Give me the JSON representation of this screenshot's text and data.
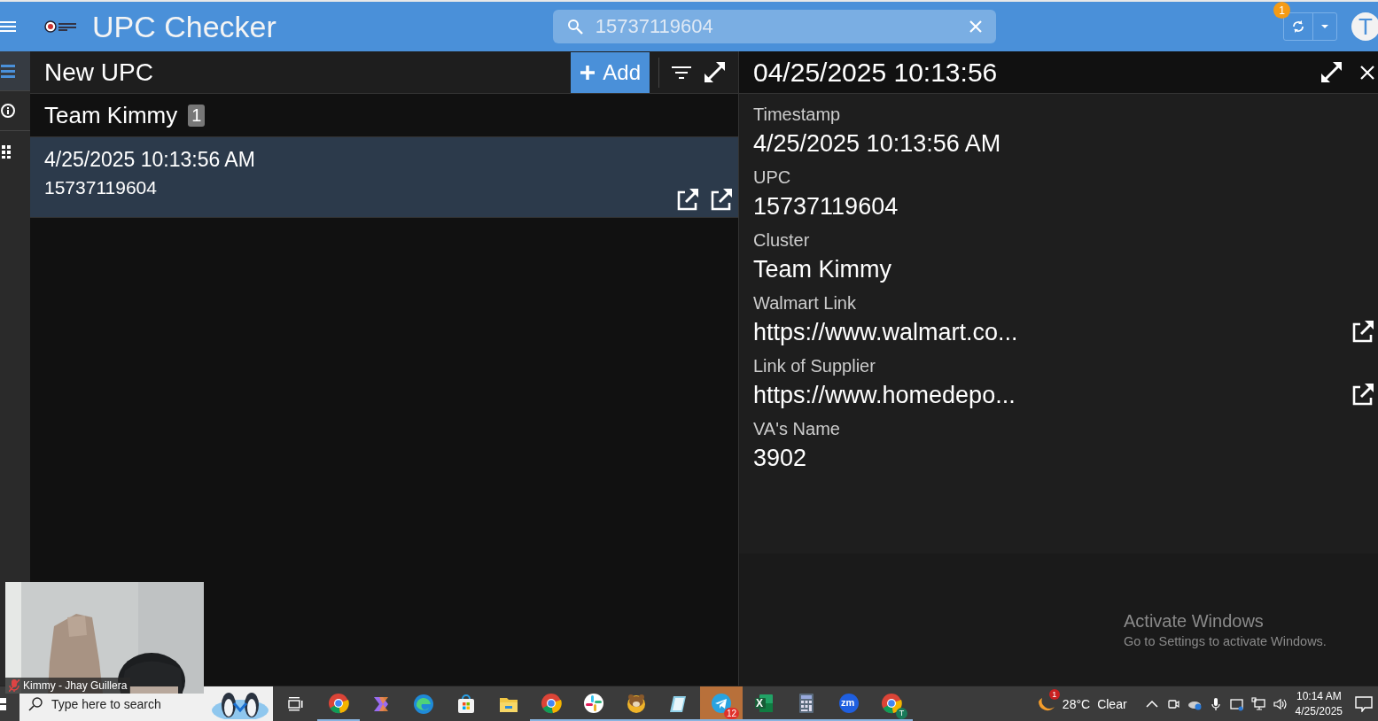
{
  "app_bar": {
    "title": "UPC Checker",
    "search": {
      "value": "15737119604"
    },
    "sync_badge": "1",
    "avatar": "T"
  },
  "rail": {
    "items": [
      {
        "selected": true
      },
      {
        "selected": false
      },
      {
        "selected": false
      }
    ]
  },
  "list_panel": {
    "title": "New UPC",
    "add_label": "Add",
    "groups": [
      {
        "name": "Team Kimmy",
        "count": "1",
        "items": [
          {
            "title": "4/25/2025 10:13:56 AM",
            "subtitle": "15737119604",
            "selected": true
          }
        ]
      }
    ]
  },
  "detail_panel": {
    "title": "04/25/2025 10:13:56",
    "fields": [
      {
        "label": "Timestamp",
        "value": "4/25/2025 10:13:56 AM",
        "kind": "text"
      },
      {
        "label": "UPC",
        "value": "15737119604",
        "kind": "text"
      },
      {
        "label": "Cluster",
        "value": "Team Kimmy",
        "kind": "text"
      },
      {
        "label": "Walmart Link",
        "value": "https://www.walmart.co...",
        "kind": "link"
      },
      {
        "label": "Link of Supplier",
        "value": "https://www.homedepo...",
        "kind": "link"
      },
      {
        "label": "VA's Name",
        "value": "3902",
        "kind": "text"
      }
    ]
  },
  "video_overlay": {
    "kind": "picture",
    "name": "Kimmy - Jhay Guillera",
    "muted": true
  },
  "activation_notice": {
    "title": "Activate Windows",
    "text": "Go to Settings to activate Windows."
  },
  "taskbar": {
    "search_placeholder": "Type here to search",
    "apps": [
      {
        "kind": "chrome",
        "running": true,
        "selected": false
      },
      {
        "kind": "copilot",
        "running": false,
        "selected": false
      },
      {
        "kind": "edge",
        "running": false,
        "selected": false
      },
      {
        "kind": "store",
        "running": false,
        "selected": false
      },
      {
        "kind": "folder",
        "running": false,
        "selected": false
      },
      {
        "kind": "chrome",
        "running": true,
        "selected": false
      },
      {
        "kind": "slack",
        "running": true,
        "selected": false
      },
      {
        "kind": "bear",
        "running": true,
        "selected": false
      },
      {
        "kind": "notepad",
        "running": true,
        "selected": false
      },
      {
        "kind": "telegram",
        "running": true,
        "selected": true,
        "badge": "12"
      },
      {
        "kind": "excel",
        "running": true,
        "selected": false,
        "letter": "X"
      },
      {
        "kind": "calculator",
        "running": true,
        "selected": false
      },
      {
        "kind": "zoom",
        "running": true,
        "selected": false,
        "letter": "zm"
      },
      {
        "kind": "chrome",
        "running": true,
        "selected": false,
        "profile": "T"
      }
    ],
    "weather": {
      "badge": "1",
      "temp": "28°C",
      "condition": "Clear"
    },
    "time": "10:14 AM",
    "date": "4/25/2025"
  }
}
